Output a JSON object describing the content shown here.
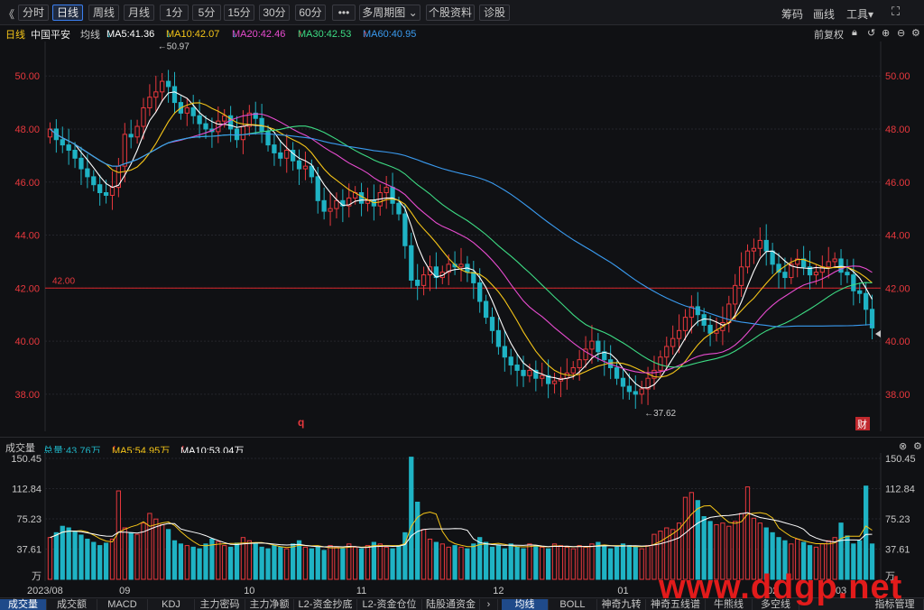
{
  "toolbar": {
    "back": "《",
    "buttons": [
      "分时",
      "日线",
      "周线",
      "月线",
      "1分",
      "5分",
      "15分",
      "30分",
      "60分",
      "•••",
      "多周期图",
      "个股资料",
      "诊股"
    ],
    "right": [
      "筹码",
      "画线",
      "工具"
    ],
    "expand": "⛶"
  },
  "legend": {
    "period": "日线",
    "stock": "中国平安",
    "avg_label": "均线",
    "ma5": "MA5:41.36",
    "ma10": "MA10:42.07",
    "ma20": "MA20:42.46",
    "ma30": "MA30:42.53",
    "ma60": "MA60:40.95",
    "adjust": "前复权"
  },
  "volume_legend": {
    "title": "成交量",
    "total": "总量:43.76万",
    "ma5": "MA5:54.95万",
    "ma10": "MA10:53.04万"
  },
  "colors": {
    "up": "#e8383d",
    "down": "#1fb3c4",
    "ma5": "#ffffff",
    "ma10": "#f5c518",
    "ma20": "#e84cd0",
    "ma30": "#3ddc84",
    "ma60": "#3a9bf0",
    "vol_ma5": "#f5c518",
    "vol_ma10": "#ffffff",
    "axis_price": "#e8383d"
  },
  "chart_data": {
    "type": "candlestick",
    "y_ticks": [
      "50.00",
      "48.00",
      "46.00",
      "44.00",
      "42.00",
      "40.00",
      "38.00"
    ],
    "ylim": [
      36.6,
      51.3
    ],
    "x_ticks": [
      "2023/08",
      "09",
      "10",
      "11",
      "12",
      "01",
      "02",
      "03"
    ],
    "annotations": {
      "high": "←50.97",
      "low": "←37.62",
      "line": "42.00",
      "marker_q": "q",
      "marker_cai": "财"
    },
    "hline": 42.0,
    "volume_ticks": [
      "150.45",
      "112.84",
      "75.23",
      "37.61",
      "万"
    ],
    "volume_ylim": [
      0,
      150.45
    ],
    "closes": [
      48.0,
      47.6,
      47.4,
      47.2,
      46.9,
      46.5,
      46.2,
      45.9,
      45.6,
      45.5,
      45.8,
      46.6,
      47.8,
      47.7,
      48.1,
      48.8,
      49.2,
      49.4,
      49.8,
      49.6,
      49.0,
      48.6,
      48.8,
      48.5,
      48.2,
      48.0,
      47.9,
      48.3,
      48.5,
      48.0,
      47.6,
      48.1,
      48.6,
      48.4,
      47.9,
      47.4,
      47.1,
      46.9,
      47.2,
      46.8,
      46.5,
      46.6,
      46.2,
      45.3,
      44.9,
      45.0,
      45.3,
      45.1,
      45.4,
      45.6,
      45.2,
      45.3,
      45.1,
      45.6,
      45.8,
      45.2,
      44.8,
      43.6,
      42.3,
      42.1,
      42.5,
      42.8,
      42.4,
      42.6,
      42.9,
      42.8,
      42.9,
      42.6,
      42.2,
      41.5,
      40.9,
      40.4,
      39.8,
      39.4,
      39.1,
      38.9,
      38.7,
      38.9,
      38.6,
      38.7,
      38.4,
      38.5,
      38.6,
      38.8,
      39.0,
      39.3,
      39.7,
      40.0,
      39.6,
      39.3,
      39.0,
      38.6,
      38.3,
      38.1,
      38.0,
      38.2,
      38.6,
      38.9,
      39.4,
      39.8,
      40.1,
      40.4,
      40.9,
      41.3,
      41.0,
      40.6,
      40.3,
      40.4,
      40.7,
      41.4,
      42.1,
      42.8,
      43.4,
      43.5,
      43.8,
      43.4,
      42.9,
      42.6,
      42.4,
      42.9,
      43.1,
      42.8,
      42.5,
      42.6,
      42.8,
      43.0,
      43.1,
      42.6,
      42.5,
      41.9,
      41.8,
      41.2,
      40.5
    ],
    "volumes": [
      52,
      58,
      66,
      64,
      60,
      55,
      50,
      46,
      42,
      45,
      50,
      110,
      64,
      58,
      56,
      70,
      82,
      75,
      68,
      62,
      48,
      44,
      42,
      40,
      38,
      44,
      50,
      47,
      42,
      40,
      45,
      52,
      48,
      44,
      40,
      38,
      42,
      40,
      38,
      44,
      48,
      40,
      38,
      40,
      36,
      42,
      40,
      38,
      44,
      40,
      38,
      42,
      46,
      44,
      40,
      38,
      42,
      58,
      152,
      96,
      62,
      50,
      46,
      44,
      40,
      42,
      40,
      38,
      44,
      52,
      46,
      40,
      42,
      38,
      44,
      40,
      38,
      44,
      42,
      40,
      38,
      44,
      42,
      40,
      38,
      42,
      40,
      44,
      46,
      42,
      38,
      40,
      44,
      42,
      40,
      38,
      42,
      56,
      60,
      64,
      62,
      70,
      102,
      108,
      98,
      78,
      72,
      68,
      70,
      66,
      72,
      82,
      115,
      76,
      70,
      64,
      58,
      52,
      48,
      44,
      50,
      46,
      42,
      40,
      44,
      48,
      52,
      70,
      54,
      44,
      48,
      116,
      44
    ]
  },
  "tabs_left": [
    "成交量",
    "成交额",
    "MACD",
    "KDJ",
    "主力密码",
    "主力净额",
    "L2-资金抄底",
    "L2-资金仓位",
    "陆股通资金"
  ],
  "tabs_more": "›",
  "tabs_right": [
    "均线",
    "BOLL",
    "神奇九转",
    "神奇五线谱",
    "牛熊线",
    "多空线",
    "指标管理"
  ],
  "watermark": "www.ddgp.net"
}
